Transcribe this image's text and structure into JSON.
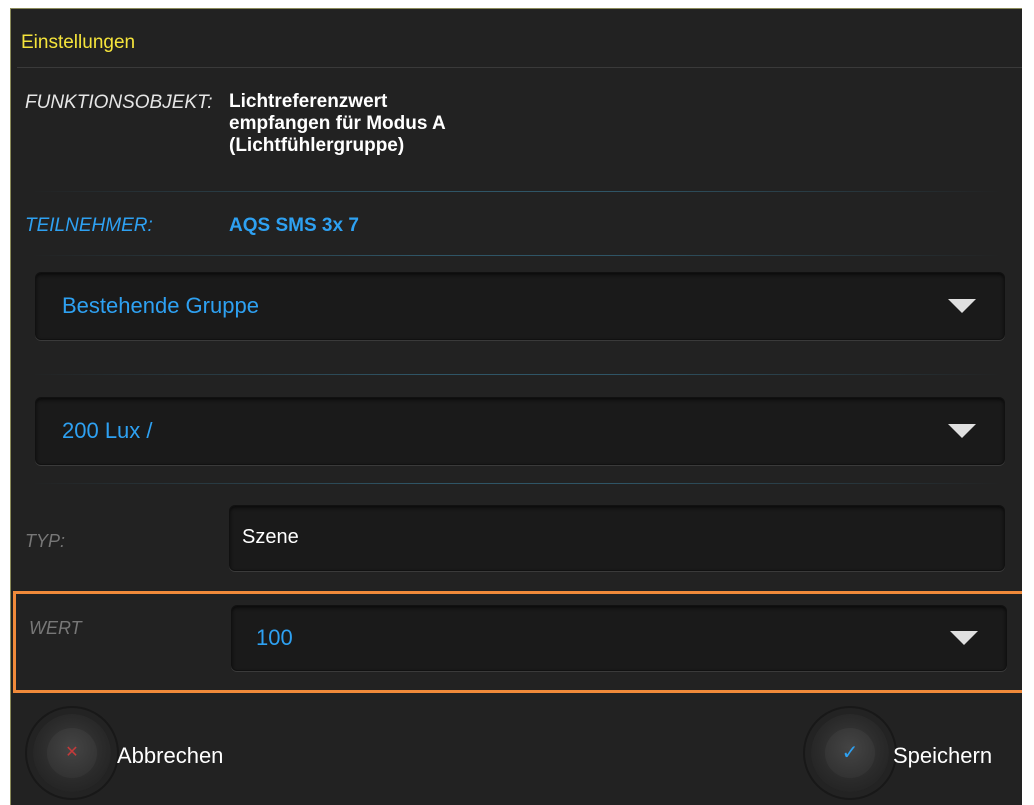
{
  "dialog": {
    "title": "Einstellungen"
  },
  "funktionsobjekt": {
    "label": "FUNKTIONSOBJEKT:",
    "value": "Lichtreferenzwert empfangen für Modus A (Lichtfühlergruppe)"
  },
  "teilnehmer": {
    "label": "TEILNEHMER:",
    "value": "AQS SMS 3x 7"
  },
  "group_dropdown": {
    "selected": "Bestehende Gruppe"
  },
  "lux_dropdown": {
    "selected": "200 Lux /"
  },
  "typ": {
    "label": "TYP:",
    "value": "Szene"
  },
  "wert": {
    "label": "WERT",
    "selected": "100"
  },
  "buttons": {
    "cancel_label": "Abbrechen",
    "cancel_icon": "x-icon",
    "save_label": "Speichern",
    "save_icon": "checkmark-icon"
  },
  "colors": {
    "title": "#f5e43b",
    "accent_blue": "#2ea1f2",
    "highlight_border": "#f08a3a",
    "cancel_icon": "#c43a3a",
    "background": "#222222"
  }
}
